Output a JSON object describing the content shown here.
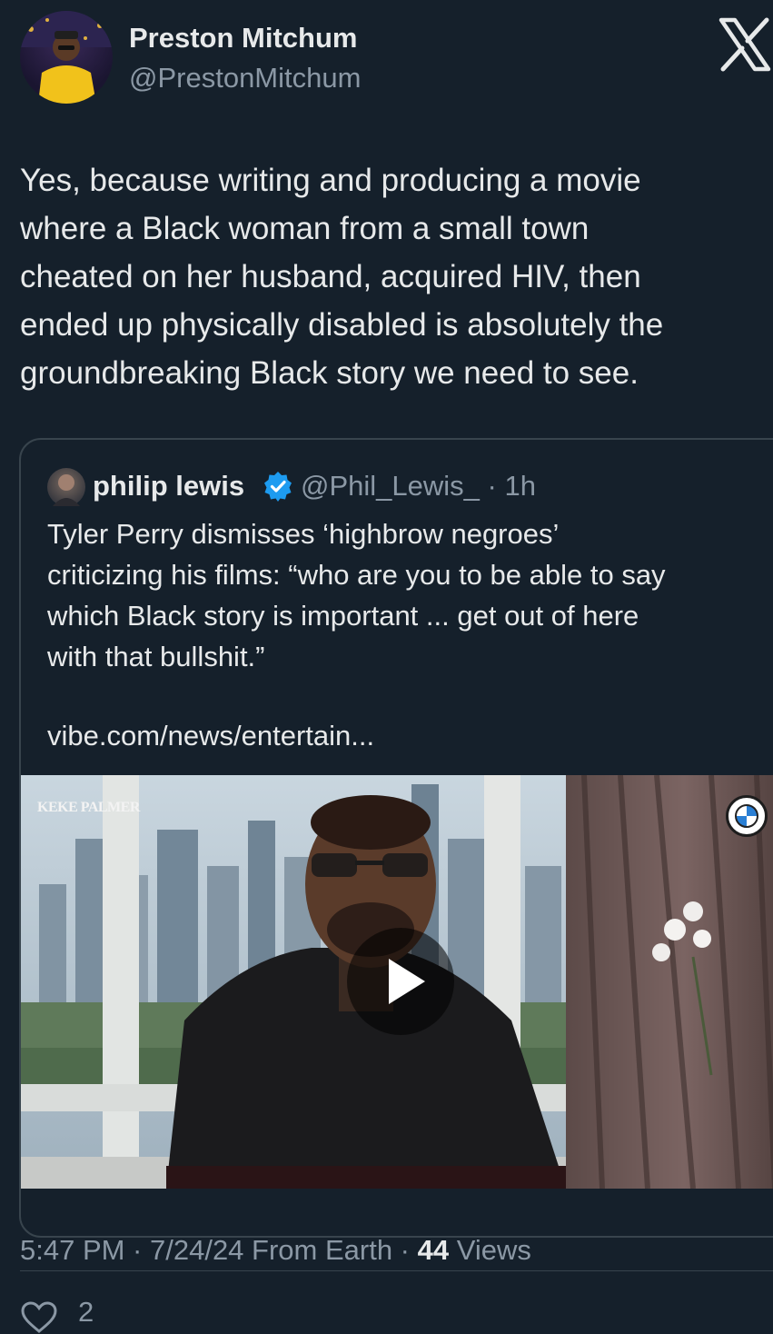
{
  "tweet": {
    "author": {
      "name": "Preston Mitchum",
      "handle": "@PrestonMitchum"
    },
    "text_lines": [
      "Yes, because writing and producing a movie",
      "where a Black woman from a small town",
      "cheated on her husband, acquired HIV, then",
      "ended up physically disabled is absolutely the",
      "groundbreaking Black story we need to see."
    ],
    "quoted": {
      "name": "philip lewis",
      "handle_time": "@Phil_Lewis_ · 1h",
      "text_lines": [
        "Tyler Perry dismisses ‘highbrow negroes’",
        "criticizing his films: “who are you to be able to say",
        "which Black story is important ... get out of here",
        "with that bullshit.”"
      ],
      "link": "vibe.com/news/entertain...",
      "media": {
        "type": "video",
        "show_logo": "KEKE PALMER",
        "play_icon": "play-icon",
        "brand_icon": "bmw-logo-icon"
      }
    },
    "meta": {
      "timestamp": "5:47 PM · 7/24/24 From Earth · ",
      "views_count": "44",
      "views_label": " Views"
    },
    "actions": {
      "like_icon": "heart-icon",
      "like_count": "2"
    }
  },
  "colors": {
    "background": "#15202b",
    "text": "#e7e9ea",
    "secondary": "#8b98a5",
    "border": "#38444d",
    "verified": "#1d9bf0"
  }
}
